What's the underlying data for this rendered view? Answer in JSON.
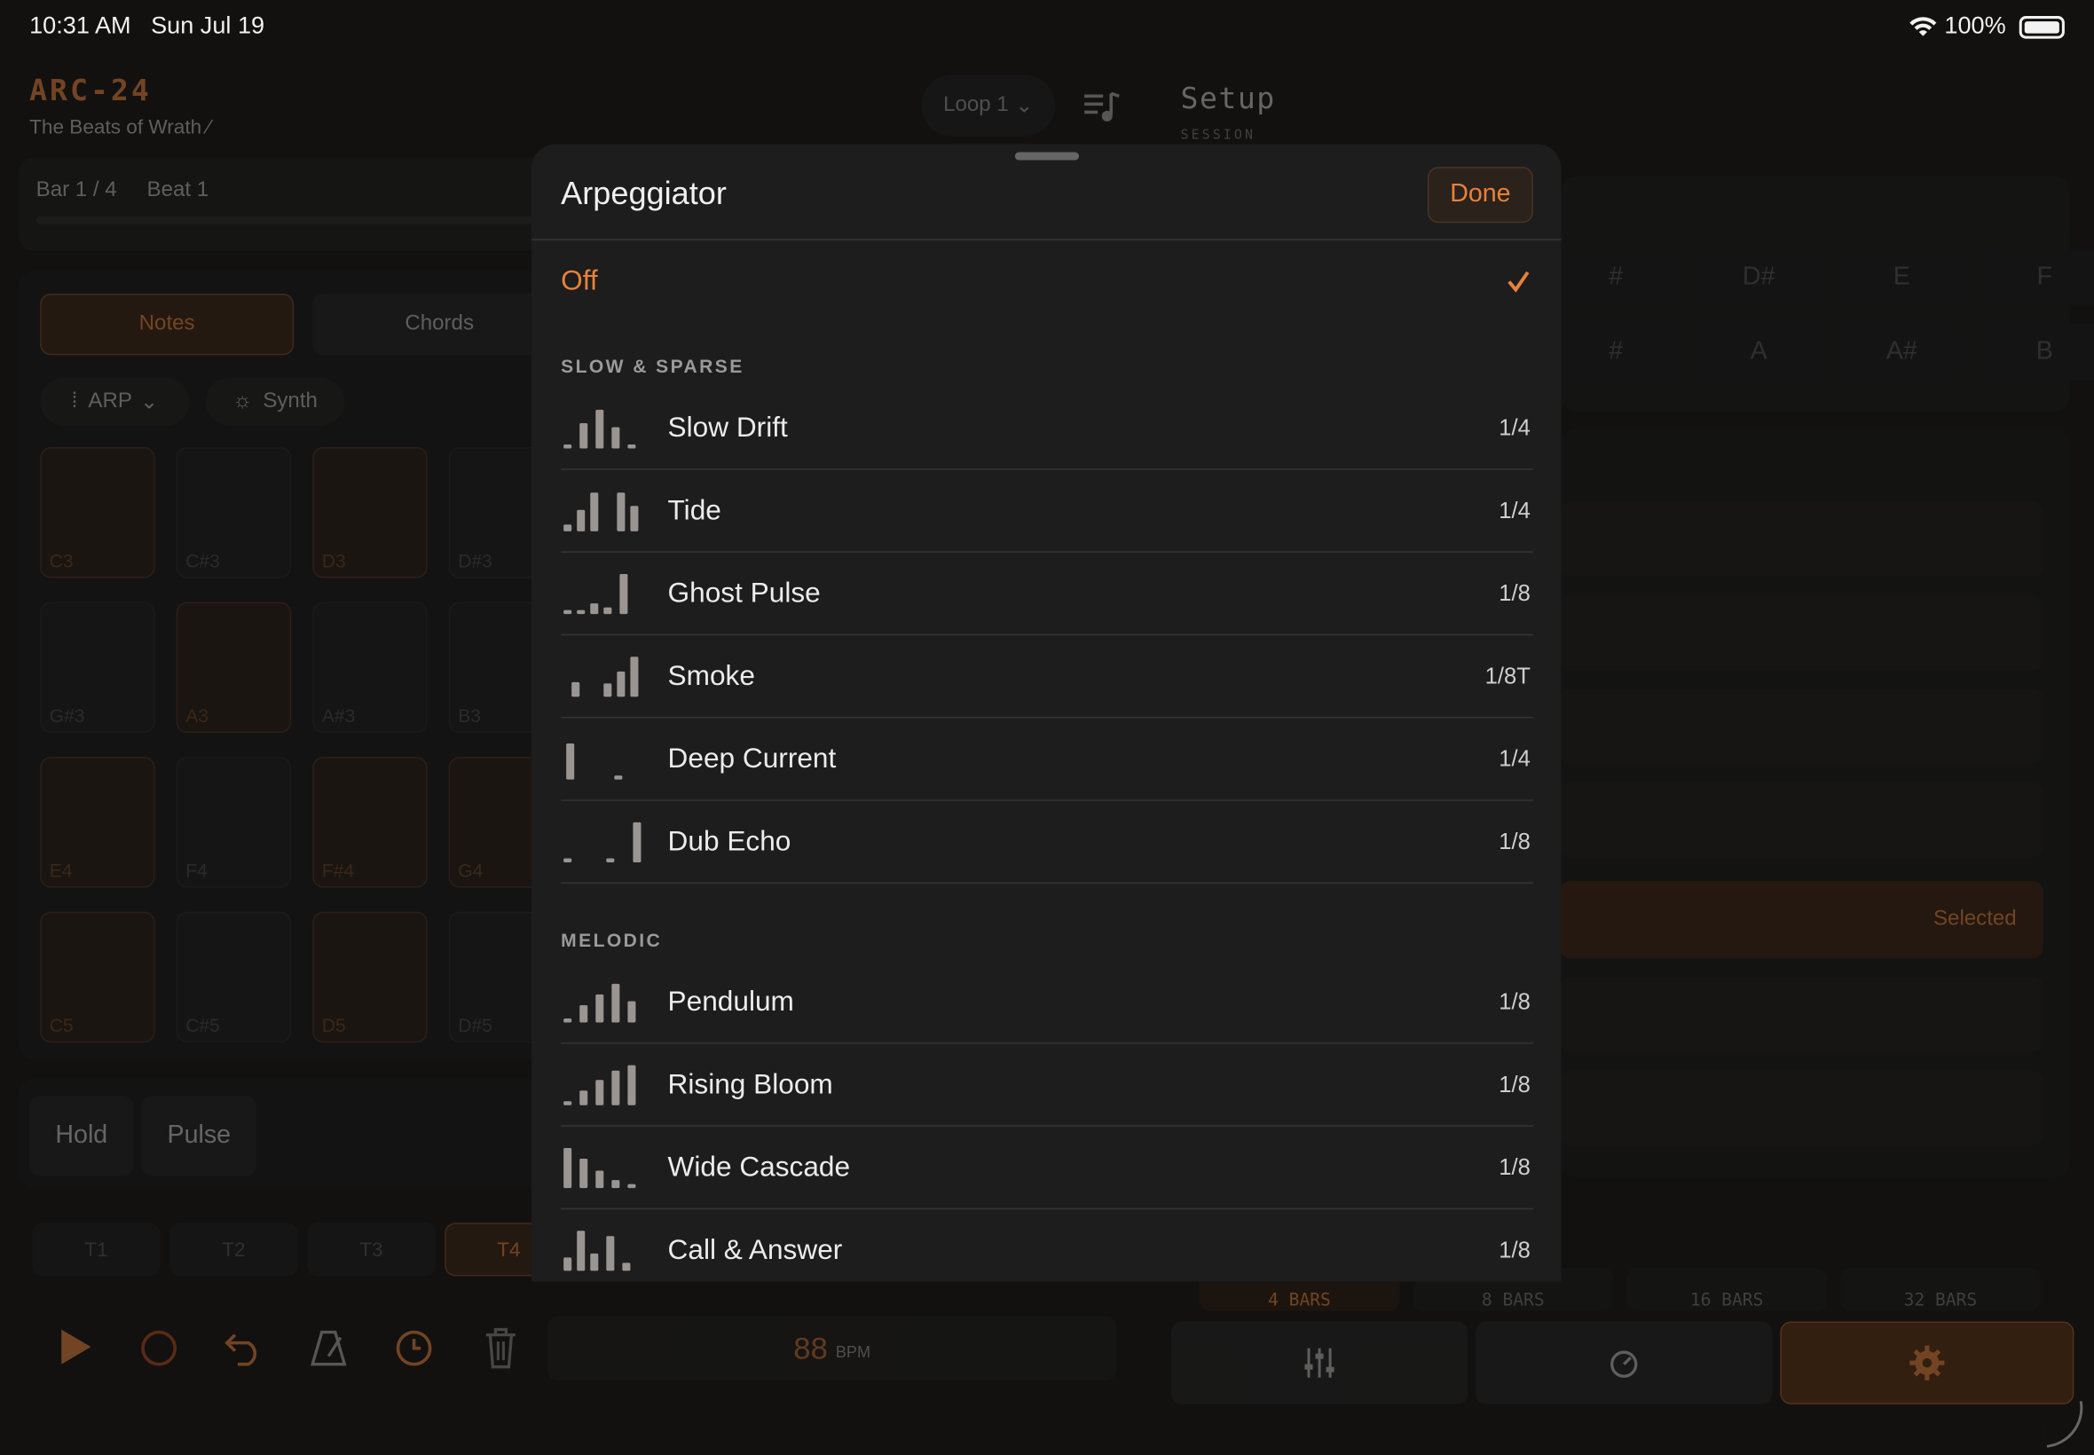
{
  "status_bar": {
    "time": "10:31 AM",
    "date": "Sun Jul 19",
    "battery": "100%"
  },
  "app": {
    "name": "ARC-24",
    "project": "The Beats of Wrath",
    "project_edit_icon": "pencil-icon"
  },
  "header": {
    "loop_selector": "Loop 1",
    "setup_title": "Setup",
    "setup_subtitle": "SESSION"
  },
  "position": {
    "bar": "Bar 1 / 4",
    "beat": "Beat 1"
  },
  "mode_tabs": {
    "notes": "Notes",
    "chords": "Chords"
  },
  "sub_controls": {
    "arp": "ARP",
    "synth": "Synth"
  },
  "pads": [
    "C3",
    "C#3",
    "D3",
    "D#3",
    "G#3",
    "A3",
    "A#3",
    "B3",
    "E4",
    "F4",
    "F#4",
    "G4",
    "C5",
    "C#5",
    "D5",
    "D#5"
  ],
  "bottom_modes": {
    "hold": "Hold",
    "pulse": "Pulse"
  },
  "tracks": [
    "T1",
    "T2",
    "T3",
    "T4"
  ],
  "transport": {
    "bpm": "88",
    "bpm_unit": "BPM"
  },
  "key_grid": [
    "#",
    "D#",
    "E",
    "F",
    "#",
    "A",
    "A#",
    "B"
  ],
  "selected_label": "Selected",
  "bar_lengths": [
    "4 BARS",
    "8 BARS",
    "16 BARS",
    "32 BARS"
  ],
  "arpeggiator": {
    "title": "Arpeggiator",
    "done": "Done",
    "off": "Off",
    "sections": [
      {
        "title": "SLOW & SPARSE",
        "items": [
          {
            "name": "Slow Drift",
            "rate": "1/4"
          },
          {
            "name": "Tide",
            "rate": "1/4"
          },
          {
            "name": "Ghost Pulse",
            "rate": "1/8"
          },
          {
            "name": "Smoke",
            "rate": "1/8T"
          },
          {
            "name": "Deep Current",
            "rate": "1/4"
          },
          {
            "name": "Dub Echo",
            "rate": "1/8"
          }
        ]
      },
      {
        "title": "MELODIC",
        "items": [
          {
            "name": "Pendulum",
            "rate": "1/8"
          },
          {
            "name": "Rising Bloom",
            "rate": "1/8"
          },
          {
            "name": "Wide Cascade",
            "rate": "1/8"
          },
          {
            "name": "Call & Answer",
            "rate": "1/8"
          }
        ]
      }
    ]
  },
  "colors": {
    "accent": "#e8823a",
    "background": "#121110",
    "sheet": "#1d1d1e"
  }
}
